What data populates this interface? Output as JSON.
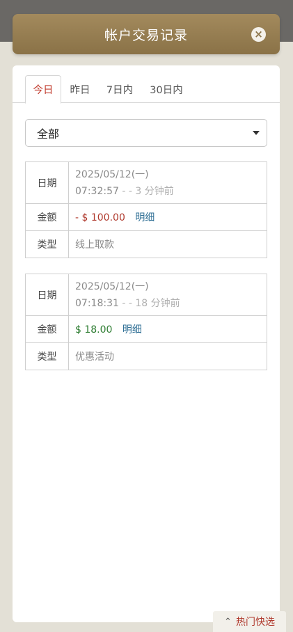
{
  "modal": {
    "title": "帐户交易记录",
    "close_label": "×"
  },
  "tabs": [
    {
      "label": "今日",
      "active": true
    },
    {
      "label": "昨日",
      "active": false
    },
    {
      "label": "7日内",
      "active": false
    },
    {
      "label": "30日内",
      "active": false
    }
  ],
  "filter": {
    "selected": "全部"
  },
  "labels": {
    "date": "日期",
    "amount": "金额",
    "type": "类型",
    "detail": "明细"
  },
  "transactions": [
    {
      "date": "2025/05/12(一)",
      "time": "07:32:57",
      "ago": " - - 3 分钟前",
      "amount": "- $ 100.00",
      "type": "线上取款"
    },
    {
      "date": "2025/05/12(一)",
      "time": "07:18:31",
      "ago": " - - 18 分钟前",
      "amount": "$ 18.00",
      "type": "优惠活动"
    }
  ],
  "hot_quick": {
    "label": "热门快选",
    "icon": "chevron-up-icon"
  },
  "colors": {
    "header": "#9b8355",
    "active_tab": "#c0392b",
    "negative": "#b03a2e",
    "positive": "#2e7d32",
    "link": "#2f6f95"
  }
}
